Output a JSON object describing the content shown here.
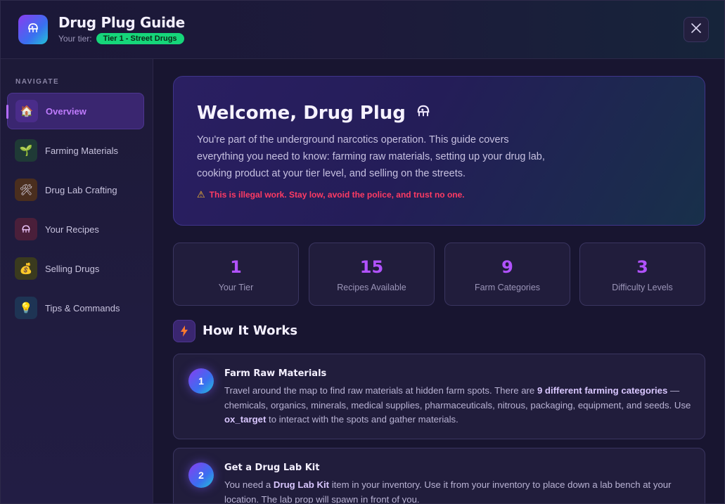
{
  "header": {
    "title": "Drug Plug Guide",
    "tier_label": "Your tier:",
    "tier_badge": "Tier 1 - Street Drugs",
    "logo_icon": "dealer-icon",
    "close_icon": "close-icon"
  },
  "sidebar": {
    "heading": "NAVIGATE",
    "items": [
      {
        "label": "Overview",
        "icon": "house-icon",
        "glyph": "🏠",
        "active": true
      },
      {
        "label": "Farming Materials",
        "icon": "seedling-icon",
        "glyph": "🌱",
        "active": false
      },
      {
        "label": "Drug Lab Crafting",
        "icon": "tools-icon",
        "glyph": "🛠",
        "active": false
      },
      {
        "label": "Your Recipes",
        "icon": "dealer-icon",
        "glyph": "ᰜ",
        "active": false
      },
      {
        "label": "Selling Drugs",
        "icon": "money-bag-icon",
        "glyph": "💰",
        "active": false
      },
      {
        "label": "Tips & Commands",
        "icon": "lightbulb-icon",
        "glyph": "💡",
        "active": false
      }
    ]
  },
  "welcome": {
    "title": "Welcome, Drug Plug",
    "text": "You're part of the underground narcotics operation. This guide covers everything you need to know: farming raw materials, setting up your drug lab, cooking product at your tier level, and selling on the streets.",
    "warning": "This is illegal work. Stay low, avoid the police, and trust no one."
  },
  "stats": [
    {
      "value": "1",
      "label": "Your Tier"
    },
    {
      "value": "15",
      "label": "Recipes Available"
    },
    {
      "value": "9",
      "label": "Farm Categories"
    },
    {
      "value": "3",
      "label": "Difficulty Levels"
    }
  ],
  "how_it_works": {
    "title": "How It Works",
    "icon": "lightning-icon",
    "steps": [
      {
        "num": "1",
        "title": "Farm Raw Materials",
        "text_1": "Travel around the map to find raw materials at hidden farm spots. There are ",
        "bold_1": "9 different farming categories",
        "text_2": " — chemicals, organics, minerals, medical supplies, pharmaceuticals, nitrous, packaging, equipment, and seeds. Use ",
        "bold_2": "ox_target",
        "text_3": " to interact with the spots and gather materials."
      },
      {
        "num": "2",
        "title": "Get a Drug Lab Kit",
        "text_1": "You need a ",
        "bold_1": "Drug Lab Kit",
        "text_2": " item in your inventory. Use it from your inventory to place down a lab bench at your location. The lab prop will spawn in front of you."
      }
    ]
  },
  "colors": {
    "accent": "#b152ff",
    "badge": "#16d67a",
    "warning": "#ff3b63"
  }
}
